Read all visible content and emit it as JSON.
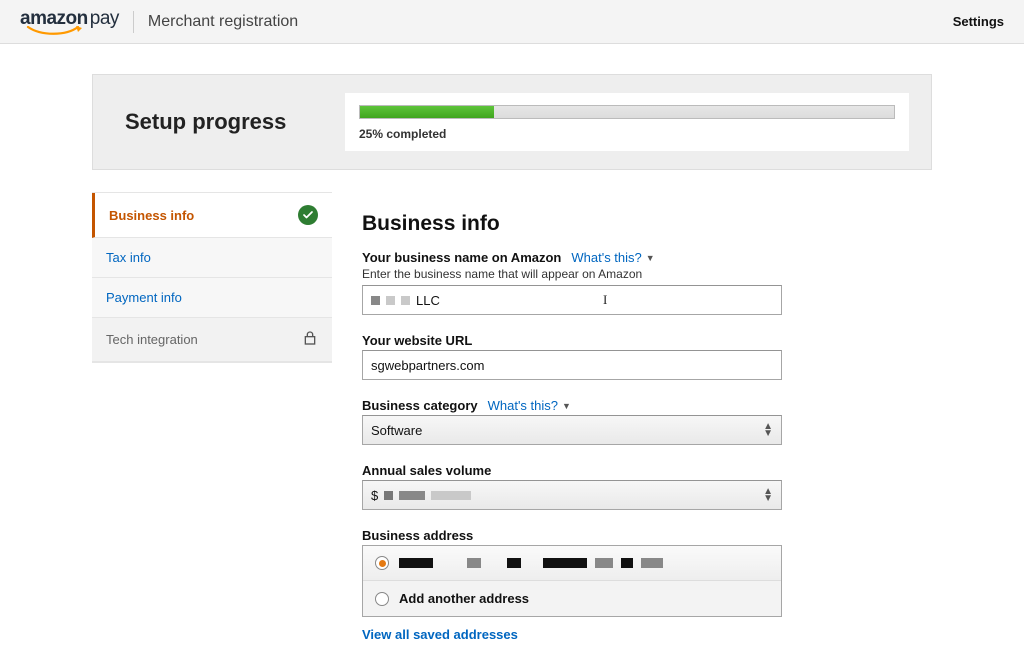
{
  "header": {
    "logo_main": "amazon",
    "logo_sub": "pay",
    "title": "Merchant registration",
    "settings_label": "Settings"
  },
  "progress": {
    "title": "Setup progress",
    "percent": 25,
    "label": "25% completed"
  },
  "steps": {
    "items": [
      {
        "label": "Business info",
        "state": "active_done"
      },
      {
        "label": "Tax info",
        "state": "link"
      },
      {
        "label": "Payment info",
        "state": "link"
      },
      {
        "label": "Tech integration",
        "state": "locked"
      }
    ]
  },
  "form": {
    "heading": "Business info",
    "business_name": {
      "label": "Your business name on Amazon",
      "help": "What's this?",
      "sublabel": "Enter the business name that will appear on Amazon",
      "value_suffix": "LLC"
    },
    "website": {
      "label": "Your website URL",
      "value": "sgwebpartners.com"
    },
    "category": {
      "label": "Business category",
      "help": "What's this?",
      "value": "Software"
    },
    "sales": {
      "label": "Annual sales volume",
      "prefix": "$"
    },
    "address": {
      "label": "Business address",
      "option_add": "Add another address",
      "view_all": "View all saved addresses"
    }
  }
}
